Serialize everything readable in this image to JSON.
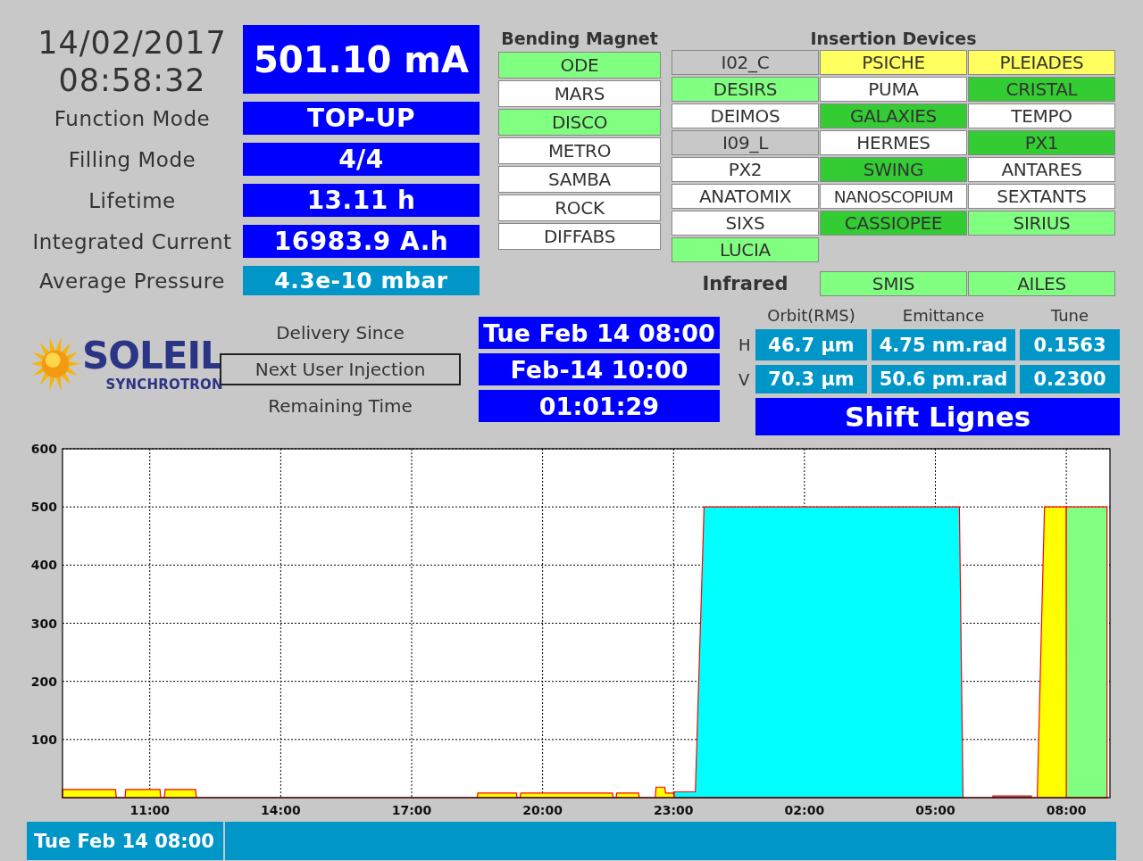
{
  "clock": {
    "date": "14/02/2017",
    "time": "08:58:32"
  },
  "beam_current": "501.10 mA",
  "parameters": [
    {
      "label": "Function Mode",
      "value": "TOP-UP",
      "kind": "primary"
    },
    {
      "label": "Filling Mode",
      "value": "4/4",
      "kind": "primary"
    },
    {
      "label": "Lifetime",
      "value": "13.11 h",
      "kind": "primary"
    },
    {
      "label": "Integrated Current",
      "value": "16983.9 A.h",
      "kind": "primary"
    },
    {
      "label": "Average Pressure",
      "value": "4.3e-10 mbar",
      "kind": "secondary"
    }
  ],
  "bending_magnet": {
    "title": "Bending Magnet",
    "beamlines": [
      {
        "name": "ODE",
        "color": "#80ff80"
      },
      {
        "name": "MARS",
        "color": "#ffffff"
      },
      {
        "name": "DISCO",
        "color": "#80ff80"
      },
      {
        "name": "METRO",
        "color": "#ffffff"
      },
      {
        "name": "SAMBA",
        "color": "#ffffff"
      },
      {
        "name": "ROCK",
        "color": "#ffffff"
      },
      {
        "name": "DIFFABS",
        "color": "#ffffff"
      }
    ]
  },
  "insertion_devices": {
    "title": "Insertion Devices",
    "beamlines": [
      {
        "name": "I02_C",
        "color": "#c8c8c8"
      },
      {
        "name": "PSICHE",
        "color": "#ffff60"
      },
      {
        "name": "PLEIADES",
        "color": "#ffff60"
      },
      {
        "name": "DESIRS",
        "color": "#80ff80"
      },
      {
        "name": "PUMA",
        "color": "#ffffff"
      },
      {
        "name": "CRISTAL",
        "color": "#33cc33"
      },
      {
        "name": "DEIMOS",
        "color": "#ffffff"
      },
      {
        "name": "GALAXIES",
        "color": "#33cc33"
      },
      {
        "name": "TEMPO",
        "color": "#ffffff"
      },
      {
        "name": "I09_L",
        "color": "#c8c8c8"
      },
      {
        "name": "HERMES",
        "color": "#ffffff"
      },
      {
        "name": "PX1",
        "color": "#33cc33"
      },
      {
        "name": "PX2",
        "color": "#ffffff"
      },
      {
        "name": "SWING",
        "color": "#33cc33"
      },
      {
        "name": "ANTARES",
        "color": "#ffffff"
      },
      {
        "name": "ANATOMIX",
        "color": "#ffffff"
      },
      {
        "name": "NANOSCOPIUM",
        "color": "#ffffff"
      },
      {
        "name": "SEXTANTS",
        "color": "#ffffff"
      },
      {
        "name": "SIXS",
        "color": "#ffffff"
      },
      {
        "name": "CASSIOPEE",
        "color": "#33cc33"
      },
      {
        "name": "SIRIUS",
        "color": "#80ff80"
      },
      {
        "name": "LUCIA",
        "color": "#80ff80"
      }
    ]
  },
  "infrared": {
    "title": "Infrared",
    "beamlines": [
      {
        "name": "SMIS",
        "color": "#80ff80"
      },
      {
        "name": "AILES",
        "color": "#80ff80"
      }
    ]
  },
  "logo": {
    "name": "SOLEIL",
    "subtitle": "SYNCHROTRON"
  },
  "delivery": [
    {
      "label": "Delivery Since",
      "value": "Tue Feb 14 08:00",
      "highlighted": false
    },
    {
      "label": "Next User Injection",
      "value": "Feb-14 10:00",
      "highlighted": true
    },
    {
      "label": "Remaining Time",
      "value": "01:01:29",
      "highlighted": false
    }
  ],
  "beam_params": {
    "columns": [
      "Orbit(RMS)",
      "Emittance",
      "Tune"
    ],
    "rows": [
      {
        "plane": "H",
        "values": [
          "46.7 µm",
          "4.75 nm.rad",
          "0.1563"
        ]
      },
      {
        "plane": "V",
        "values": [
          "70.3 µm",
          "50.6 pm.rad",
          "0.2300"
        ]
      }
    ]
  },
  "shift": "Shift Lignes",
  "chart_data": {
    "type": "area",
    "grid": true,
    "x": [
      "2017-02-13T09:00",
      "2017-02-13T10:13",
      "2017-02-13T10:14",
      "2017-02-13T10:26",
      "2017-02-13T10:27",
      "2017-02-13T11:14",
      "2017-02-13T11:15",
      "2017-02-13T11:20",
      "2017-02-13T11:21",
      "2017-02-13T12:03",
      "2017-02-13T12:04",
      "2017-02-13T18:30",
      "2017-02-13T18:31",
      "2017-02-13T19:24",
      "2017-02-13T19:25",
      "2017-02-13T19:29",
      "2017-02-13T19:30",
      "2017-02-13T21:36",
      "2017-02-13T21:37",
      "2017-02-13T21:41",
      "2017-02-13T21:42",
      "2017-02-13T22:12",
      "2017-02-13T22:13",
      "2017-02-13T22:35",
      "2017-02-13T22:36",
      "2017-02-13T22:48",
      "2017-02-13T22:49",
      "2017-02-13T23:00",
      "2017-02-13T23:01",
      "2017-02-13T23:30",
      "2017-02-13T23:42",
      "2017-02-14T05:33",
      "2017-02-14T05:38",
      "2017-02-14T06:18",
      "2017-02-14T06:19",
      "2017-02-14T07:12",
      "2017-02-14T07:13",
      "2017-02-14T07:20",
      "2017-02-14T07:30",
      "2017-02-14T07:59",
      "2017-02-14T08:00",
      "2017-02-14T08:01",
      "2017-02-14T08:56"
    ],
    "series": [
      {
        "color": "#ffff00",
        "values": [
          14,
          14,
          0,
          0,
          14,
          14,
          0,
          0,
          14,
          14,
          0,
          0,
          8,
          8,
          0,
          0,
          8,
          8,
          0,
          0,
          8,
          8,
          0,
          0,
          18,
          18,
          8,
          8,
          0,
          0,
          0,
          0,
          0,
          0,
          0,
          0,
          0,
          0,
          500,
          500,
          500,
          0,
          0
        ]
      },
      {
        "color": "#00ffff",
        "values": [
          null,
          null,
          null,
          null,
          null,
          null,
          null,
          null,
          null,
          null,
          null,
          null,
          null,
          null,
          null,
          null,
          null,
          null,
          null,
          null,
          null,
          null,
          null,
          null,
          null,
          null,
          null,
          null,
          10,
          10,
          500,
          500,
          0,
          null,
          3,
          3,
          null,
          null,
          null,
          null,
          null,
          null,
          null
        ]
      },
      {
        "color": "#80ff80",
        "values": [
          null,
          null,
          null,
          null,
          null,
          null,
          null,
          null,
          null,
          null,
          null,
          null,
          null,
          null,
          null,
          null,
          null,
          null,
          null,
          null,
          null,
          null,
          null,
          null,
          null,
          null,
          null,
          null,
          null,
          null,
          null,
          null,
          null,
          null,
          null,
          null,
          null,
          null,
          null,
          null,
          500,
          500,
          500
        ]
      }
    ],
    "xlim": [
      "2017-02-13T09:00",
      "2017-02-14T09:00"
    ],
    "ylim": [
      0,
      600
    ],
    "xticks": [
      {
        "value": "2017-02-13T11:00",
        "label": "11:00"
      },
      {
        "value": "2017-02-13T14:00",
        "label": "14:00"
      },
      {
        "value": "2017-02-13T17:00",
        "label": "17:00"
      },
      {
        "value": "2017-02-13T20:00",
        "label": "20:00"
      },
      {
        "value": "2017-02-13T23:00",
        "label": "23:00"
      },
      {
        "value": "2017-02-14T02:00",
        "label": "02:00"
      },
      {
        "value": "2017-02-14T05:00",
        "label": "05:00"
      },
      {
        "value": "2017-02-14T08:00",
        "label": "08:00"
      }
    ],
    "yticks": [
      100,
      200,
      300,
      400,
      500,
      600
    ]
  },
  "status_bar": {
    "text": "Tue Feb 14 08:00"
  }
}
